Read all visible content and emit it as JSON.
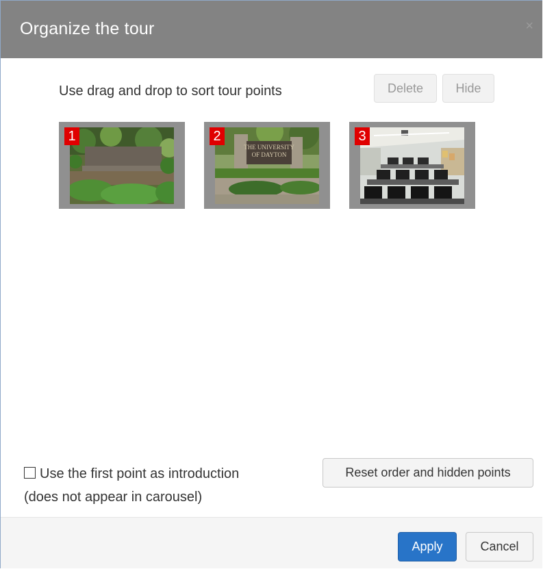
{
  "dialog": {
    "title": "Organize the tour",
    "close_glyph": "×"
  },
  "toolbar": {
    "instructions": "Use drag and drop to sort tour points",
    "delete_label": "Delete",
    "hide_label": "Hide"
  },
  "tour_points": [
    {
      "number": "1",
      "image": "campus-stone-sign-photo"
    },
    {
      "number": "2",
      "image": "university-of-dayton-sign-photo"
    },
    {
      "number": "3",
      "image": "computer-lab-classroom-photo"
    }
  ],
  "photo_text": {
    "sign2_line1": "THE UNIVERSITY",
    "sign2_line2": "OF DAYTON"
  },
  "options": {
    "intro_checkbox_line1": "Use the first point as introduction",
    "intro_checkbox_line2": "(does not appear in carousel)",
    "intro_checked": false,
    "reset_label": "Reset order and hidden points"
  },
  "footer": {
    "apply_label": "Apply",
    "cancel_label": "Cancel"
  },
  "colors": {
    "header_bg": "#838383",
    "badge_red": "#e00000",
    "apply_blue": "#2874c8"
  }
}
